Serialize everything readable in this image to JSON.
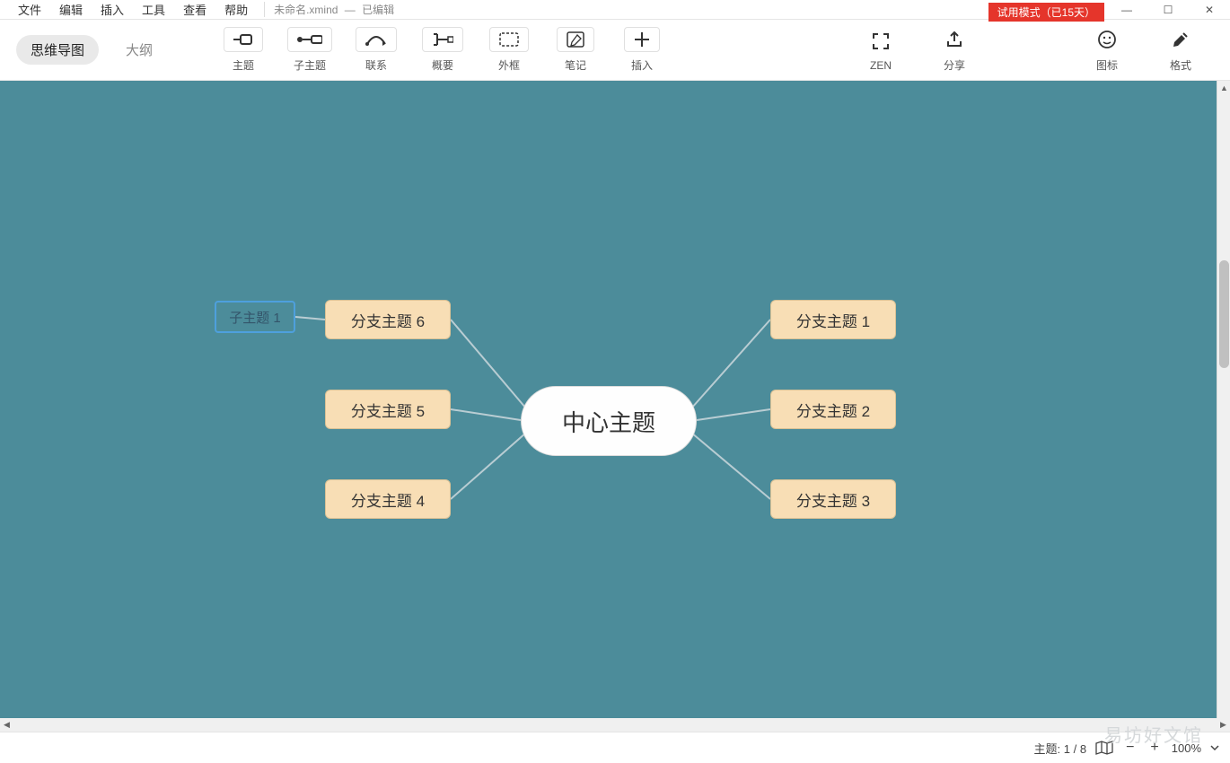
{
  "menu": {
    "file": "文件",
    "edit": "编辑",
    "insert": "插入",
    "tools": "工具",
    "view": "查看",
    "help": "帮助"
  },
  "title": {
    "filename": "未命名.xmind",
    "status": "已编辑"
  },
  "trial_banner": "试用模式（已15天）",
  "view_tabs": {
    "mindmap": "思维导图",
    "outline": "大纲"
  },
  "tools": {
    "topic": "主题",
    "subtopic": "子主题",
    "relation": "联系",
    "summary": "概要",
    "boundary": "外框",
    "note": "笔记",
    "insert": "插入",
    "zen": "ZEN",
    "share": "分享",
    "icons": "图标",
    "format": "格式"
  },
  "mindmap": {
    "center": "中心主题",
    "branches": [
      "分支主题 1",
      "分支主题 2",
      "分支主题 3",
      "分支主题 4",
      "分支主题 5",
      "分支主题 6"
    ],
    "sub": "子主题 1"
  },
  "status": {
    "topic_label": "主题:",
    "topic_count": "1 / 8",
    "zoom": "100%"
  },
  "watermark": "易坊好文馆",
  "colors": {
    "canvas": "#4c8c9a",
    "branch": "#f8deb5",
    "trial": "#e5352b",
    "selection": "#4ea0dd"
  }
}
